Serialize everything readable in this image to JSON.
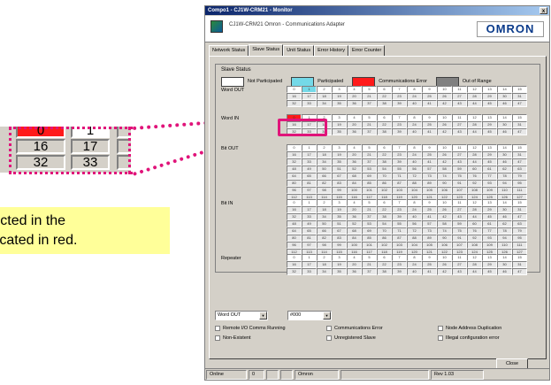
{
  "callout": {
    "cells_row1": [
      "0",
      "1",
      ""
    ],
    "cells_row2": [
      "16",
      "17",
      ""
    ],
    "cells_row3": [
      "32",
      "33",
      ""
    ],
    "note_line1": "etected in the",
    "note_line2": "ndicated in red.",
    "accent_color": "#e0147a"
  },
  "window": {
    "title": "Compo1 - CJ1W-CRM21 - Monitor",
    "close_glyph": "x",
    "app_title": "CJ1W-CRM21  Omron - Communications Adapter",
    "logo": "OMRON",
    "tabs": [
      "Network Status",
      "Slave Status",
      "Unit Status",
      "Error History",
      "Error Counter"
    ],
    "active_tab": "Slave Status",
    "group_title": "Slave Status",
    "legend": [
      {
        "label": "Not Participated",
        "color": "#ffffff"
      },
      {
        "label": "Participated",
        "color": "#74d9e8"
      },
      {
        "label": "Communications Error",
        "color": "#ff1a1a"
      },
      {
        "label": "Out of Range",
        "color": "#808080"
      }
    ],
    "sections": [
      {
        "label": "Word OUT",
        "rows": 3
      },
      {
        "label": "Word IN",
        "rows": 3
      },
      {
        "label": "Bit OUT",
        "rows": 8
      },
      {
        "label": "Bit IN",
        "rows": 8
      },
      {
        "label": "Repeater",
        "rows": 3
      }
    ],
    "participated_cells": {
      "Word OUT": [
        1
      ]
    },
    "error_cells": {
      "Word IN": [
        0
      ]
    },
    "combo1_value": "Word OUT",
    "combo2_value": "#000",
    "checkboxes": [
      "Remote I/O Comms Running",
      "Non-Existent",
      "Communications Error",
      "Unregistered Slave",
      "Node Address Duplication",
      "Illegal configuration error"
    ],
    "close_label": "Close",
    "status": [
      "Online",
      "0",
      "",
      "",
      "Omron",
      "",
      "Rev 1.03"
    ]
  }
}
